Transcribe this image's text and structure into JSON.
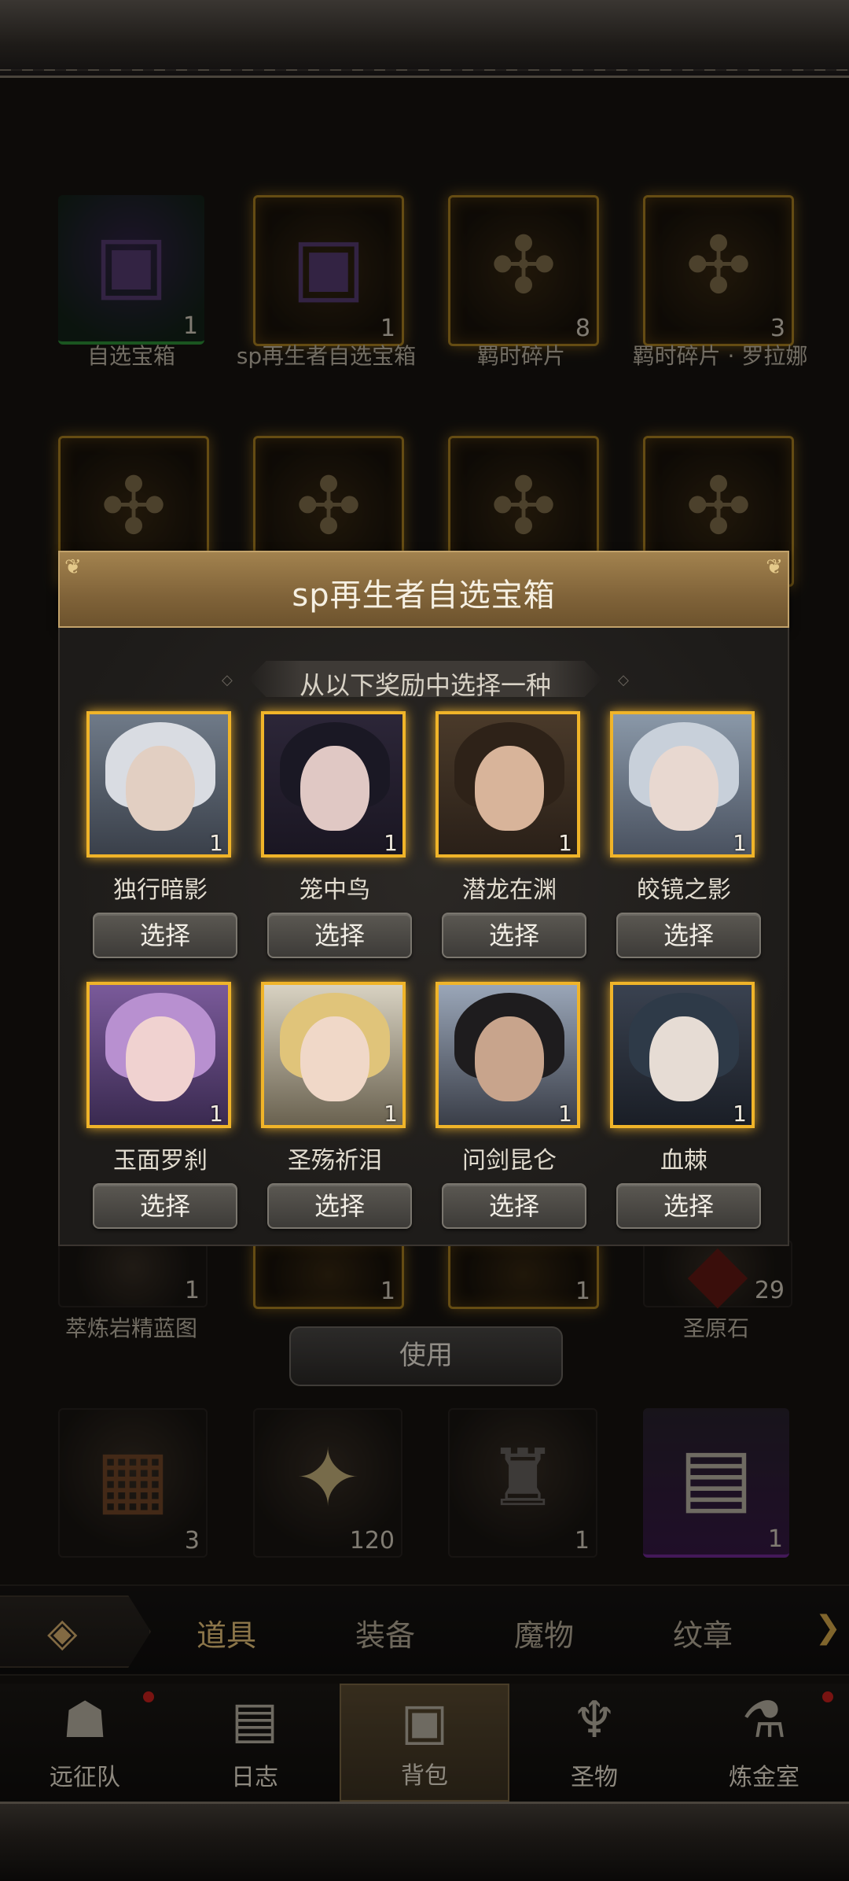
{
  "inventory": {
    "items": [
      {
        "name": "自选宝箱",
        "count": "1"
      },
      {
        "name": "sp再生者自选宝箱",
        "count": "1"
      },
      {
        "name": "羁时碎片",
        "count": "8"
      },
      {
        "name": "羁时碎片 · 罗拉娜",
        "count": "3"
      },
      {
        "name": "萃炼岩精蓝图",
        "count": "1"
      },
      {
        "name": "",
        "count": "1"
      },
      {
        "name": "",
        "count": "1"
      },
      {
        "name": "圣原石",
        "count": "29"
      },
      {
        "name": "",
        "count": "3"
      },
      {
        "name": "",
        "count": "120"
      },
      {
        "name": "",
        "count": "1"
      },
      {
        "name": "",
        "count": "1"
      }
    ],
    "use_label": "使用"
  },
  "modal": {
    "title": "sp再生者自选宝箱",
    "subtitle": "从以下奖励中选择一种",
    "select_label": "选择",
    "rewards": [
      {
        "name": "独行暗影",
        "count": "1"
      },
      {
        "name": "笼中鸟",
        "count": "1"
      },
      {
        "name": "潜龙在渊",
        "count": "1"
      },
      {
        "name": "皎镜之影",
        "count": "1"
      },
      {
        "name": "玉面罗刹",
        "count": "1"
      },
      {
        "name": "圣殇祈泪",
        "count": "1"
      },
      {
        "name": "问剑昆仑",
        "count": "1"
      },
      {
        "name": "血棘",
        "count": "1"
      }
    ]
  },
  "tabs": [
    "道具",
    "装备",
    "魔物",
    "纹章"
  ],
  "active_tab": "道具",
  "nav": [
    {
      "label": "远征队",
      "icon": "helmet-icon",
      "badge": true
    },
    {
      "label": "日志",
      "icon": "scroll-icon",
      "badge": false
    },
    {
      "label": "背包",
      "icon": "backpack-icon",
      "badge": false
    },
    {
      "label": "圣物",
      "icon": "chalice-icon",
      "badge": false
    },
    {
      "label": "炼金室",
      "icon": "alchemy-icon",
      "badge": true
    }
  ],
  "active_nav": "背包",
  "colors": {
    "gold_frame": "#f0b429",
    "header": "#8c6d3f",
    "badge": "#c8201c"
  }
}
